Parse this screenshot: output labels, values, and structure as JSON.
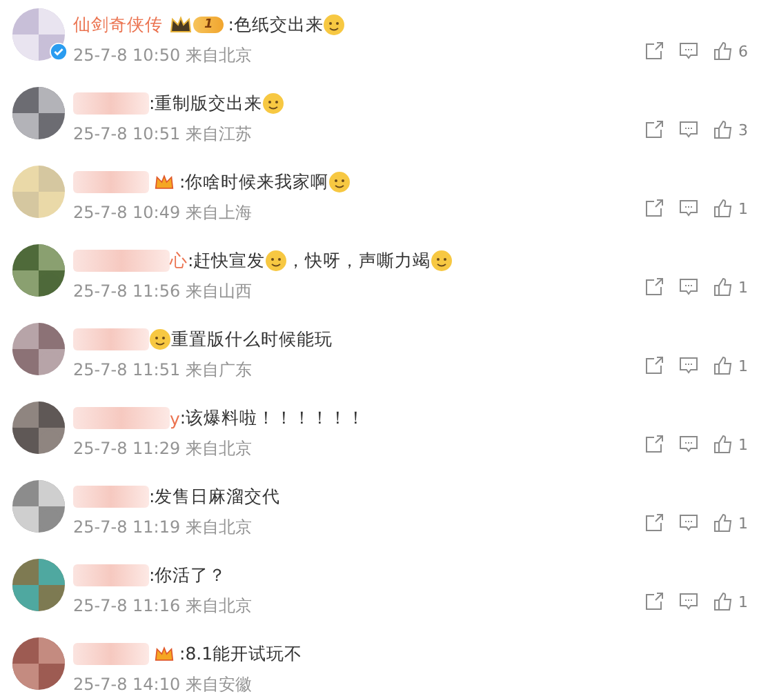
{
  "comments": [
    {
      "name": "仙剑奇侠传",
      "verified": true,
      "crown": true,
      "level": "1",
      "content": [
        {
          "kind": "text",
          "text": ":色纸交出来"
        },
        {
          "kind": "emoji"
        }
      ],
      "time": "25-7-8 10:50 来自北京",
      "likes": "6"
    },
    {
      "content": [
        {
          "kind": "text",
          "text": ":重制版交出来"
        },
        {
          "kind": "emoji"
        }
      ],
      "time": "25-7-8 10:51 来自江苏",
      "likes": "3"
    },
    {
      "vip": true,
      "content": [
        {
          "kind": "text",
          "text": ":你啥时候来我家啊"
        },
        {
          "kind": "emoji"
        }
      ],
      "time": "25-7-8 10:49 来自上海",
      "likes": "1"
    },
    {
      "name": "心",
      "content": [
        {
          "kind": "text",
          "text": ":赶快宣发"
        },
        {
          "kind": "emoji"
        },
        {
          "kind": "text",
          "text": "，快呀，声嘶力竭"
        },
        {
          "kind": "emoji"
        }
      ],
      "time": "25-7-8 11:56 来自山西",
      "likes": "1"
    },
    {
      "content": [
        {
          "kind": "emoji"
        },
        {
          "kind": "text",
          "text": "重置版什么时候能玩"
        }
      ],
      "time": "25-7-8 11:51 来自广东",
      "likes": "1"
    },
    {
      "name": "y",
      "content": [
        {
          "kind": "text",
          "text": ":该爆料啦！！！！！！"
        }
      ],
      "time": "25-7-8 11:29 来自北京",
      "likes": "1"
    },
    {
      "content": [
        {
          "kind": "text",
          "text": ":发售日麻溜交代"
        }
      ],
      "time": "25-7-8 11:19 来自北京",
      "likes": "1"
    },
    {
      "content": [
        {
          "kind": "text",
          "text": ":你活了？"
        }
      ],
      "time": "25-7-8 11:16 来自北京",
      "likes": "1"
    },
    {
      "vip": true,
      "content": [
        {
          "kind": "text",
          "text": ":8.1能开试玩不"
        }
      ],
      "time": "25-7-8 14:10 来自安徽"
    }
  ]
}
